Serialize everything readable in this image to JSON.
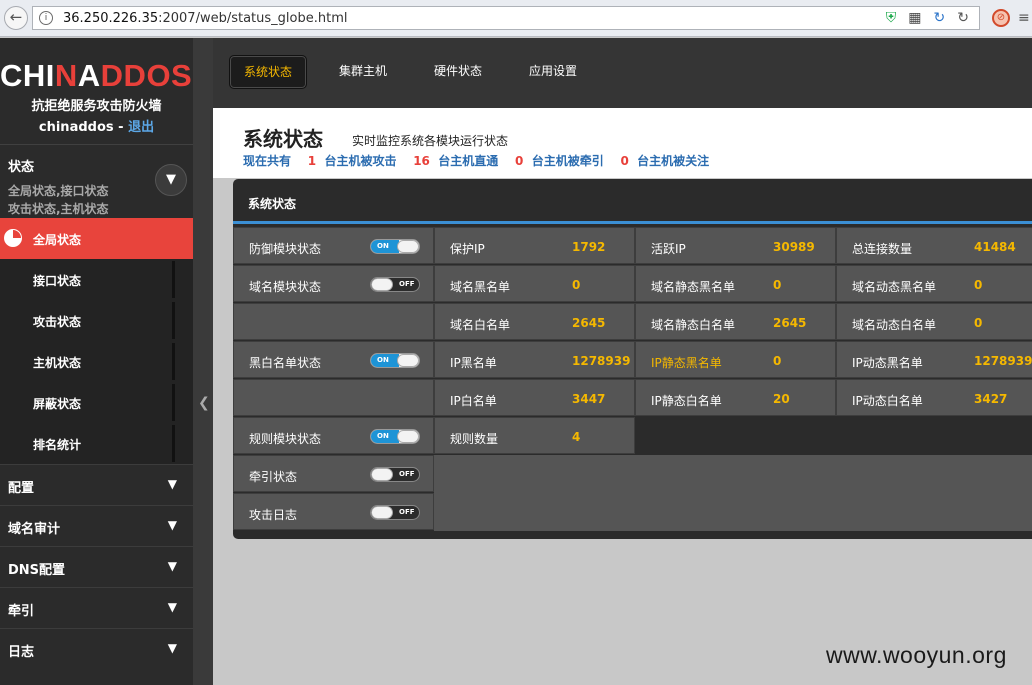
{
  "browser": {
    "url_host": "36.250.226.35",
    "url_rest": ":2007/web/status_globe.html"
  },
  "sidebar": {
    "logo_white1": "CHI",
    "logo_red1": "N",
    "logo_white2": "A",
    "logo_red2": "DDOS",
    "slogan": "抗拒绝服务攻击防火墙",
    "user": "chinaddos",
    "user_sep": " - ",
    "logout": "退出",
    "status_section": {
      "title": "状态",
      "sub1": "全局状态,接口状态",
      "sub2": "攻击状态,主机状态",
      "items": [
        {
          "label": "全局状态"
        },
        {
          "label": "接口状态"
        },
        {
          "label": "攻击状态"
        },
        {
          "label": "主机状态"
        },
        {
          "label": "屏蔽状态"
        },
        {
          "label": "排名统计"
        }
      ]
    },
    "nav": [
      {
        "label": "配置"
      },
      {
        "label": "域名审计"
      },
      {
        "label": "DNS配置"
      },
      {
        "label": "牵引"
      },
      {
        "label": "日志"
      }
    ]
  },
  "topnav": {
    "tabs": [
      {
        "label": "系统状态"
      },
      {
        "label": "集群主机"
      },
      {
        "label": "硬件状态"
      },
      {
        "label": "应用设置"
      }
    ]
  },
  "page": {
    "title": "系统状态",
    "subtitle": "实时监控系统各模块运行状态",
    "summary": {
      "prefix": "现在共有",
      "attacked_count": "1",
      "attacked_label": "台主机被攻击",
      "direct_count": "16",
      "direct_label": "台主机直通",
      "traction_count": "0",
      "traction_label": "台主机被牵引",
      "watched_count": "0",
      "watched_label": "台主机被关注"
    }
  },
  "panel": {
    "title": "系统状态",
    "modules": [
      {
        "label": "防御模块状态",
        "toggle": "ON"
      },
      {
        "label": "域名模块状态",
        "toggle": "OFF"
      },
      {
        "label": "",
        "toggle": ""
      },
      {
        "label": "黑白名单状态",
        "toggle": "ON"
      },
      {
        "label": "",
        "toggle": ""
      },
      {
        "label": "规则模块状态",
        "toggle": "ON"
      },
      {
        "label": "牵引状态",
        "toggle": "OFF"
      },
      {
        "label": "攻击日志",
        "toggle": "OFF"
      }
    ],
    "stats": [
      [
        {
          "k": "保护IP",
          "v": "1792"
        },
        {
          "k": "活跃IP",
          "v": "30989"
        },
        {
          "k": "总连接数量",
          "v": "41484"
        }
      ],
      [
        {
          "k": "域名黑名单",
          "v": "0"
        },
        {
          "k": "域名静态黑名单",
          "v": "0"
        },
        {
          "k": "域名动态黑名单",
          "v": "0"
        }
      ],
      [
        {
          "k": "域名白名单",
          "v": "2645"
        },
        {
          "k": "域名静态白名单",
          "v": "2645"
        },
        {
          "k": "域名动态白名单",
          "v": "0"
        }
      ],
      [
        {
          "k": "IP黑名单",
          "v": "1278939"
        },
        {
          "k": "IP静态黑名单",
          "v": "0"
        },
        {
          "k": "IP动态黑名单",
          "v": "1278939"
        }
      ],
      [
        {
          "k": "IP白名单",
          "v": "3447"
        },
        {
          "k": "IP静态白名单",
          "v": "20"
        },
        {
          "k": "IP动态白名单",
          "v": "3427"
        }
      ],
      [
        {
          "k": "规则数量",
          "v": "4"
        }
      ]
    ]
  },
  "watermark": "www.wooyun.org"
}
